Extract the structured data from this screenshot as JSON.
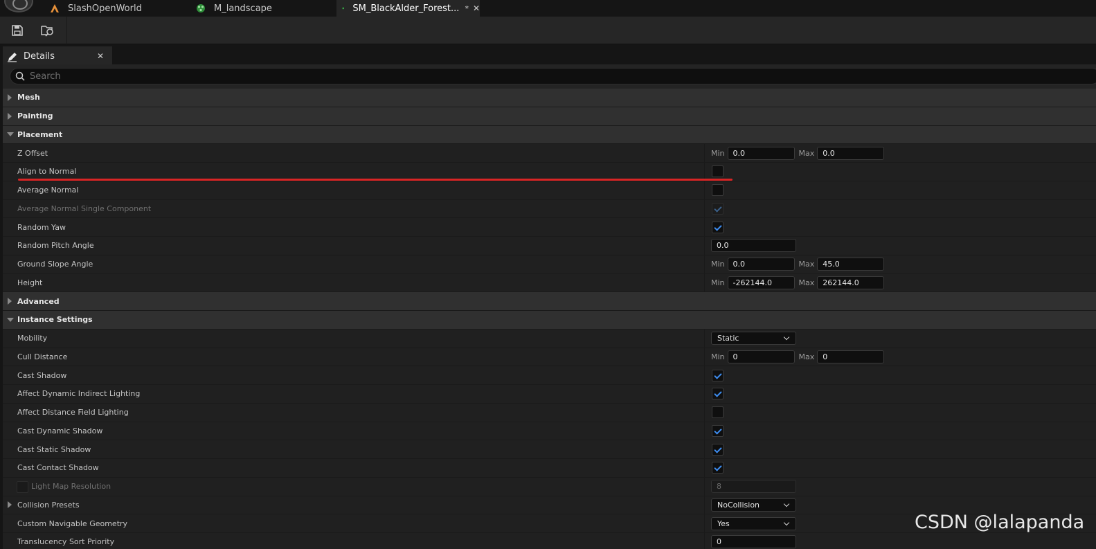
{
  "tabs": [
    {
      "label": "SlashOpenWorld",
      "icon": "level-icon"
    },
    {
      "label": "M_landscape",
      "icon": "material-icon"
    },
    {
      "label": "SM_BlackAlder_Forest...",
      "icon": "foliage-icon",
      "modified": "*",
      "close": "✕"
    }
  ],
  "toolbar": {
    "save": "save-icon",
    "browse": "browse-asset-icon"
  },
  "panel": {
    "title": "Details",
    "close": "✕"
  },
  "search": {
    "placeholder": "Search"
  },
  "rows": [
    {
      "type": "cat",
      "label": "Mesh",
      "expanded": false
    },
    {
      "type": "cat",
      "label": "Painting",
      "expanded": false
    },
    {
      "type": "cat",
      "label": "Placement",
      "expanded": true
    },
    {
      "type": "prop",
      "label": "Z Offset",
      "min": "0.0",
      "max": "0.0"
    },
    {
      "type": "prop",
      "label": "Align to Normal",
      "checked": false
    },
    {
      "type": "prop",
      "label": "Average Normal",
      "checked": false
    },
    {
      "type": "prop",
      "label": "Average Normal Single Component",
      "checked": true,
      "disabled": true
    },
    {
      "type": "prop",
      "label": "Random Yaw",
      "checked": true
    },
    {
      "type": "prop",
      "label": "Random Pitch Angle",
      "value": "0.0"
    },
    {
      "type": "prop",
      "label": "Ground Slope Angle",
      "min": "0.0",
      "max": "45.0"
    },
    {
      "type": "prop",
      "label": "Height",
      "min": "-262144.0",
      "max": "262144.0"
    },
    {
      "type": "cat",
      "label": "Advanced",
      "expanded": false,
      "sub": true
    },
    {
      "type": "cat",
      "label": "Instance Settings",
      "expanded": true
    },
    {
      "type": "prop",
      "label": "Mobility",
      "select": "Static"
    },
    {
      "type": "prop",
      "label": "Cull Distance",
      "min": "0",
      "max": "0"
    },
    {
      "type": "prop",
      "label": "Cast Shadow",
      "checked": true
    },
    {
      "type": "prop",
      "label": "Affect Dynamic Indirect Lighting",
      "checked": true
    },
    {
      "type": "prop",
      "label": "Affect Distance Field Lighting",
      "checked": false
    },
    {
      "type": "prop",
      "label": "Cast Dynamic Shadow",
      "checked": true
    },
    {
      "type": "prop",
      "label": "Cast Static Shadow",
      "checked": true
    },
    {
      "type": "prop",
      "label": "Cast Contact Shadow",
      "checked": true
    },
    {
      "type": "prop",
      "label": "Light Map Resolution",
      "value": "8",
      "disabled": true,
      "override": true
    },
    {
      "type": "prop",
      "label": "Collision Presets",
      "select": "NoCollision",
      "expandable": true
    },
    {
      "type": "prop",
      "label": "Custom Navigable Geometry",
      "select": "Yes"
    },
    {
      "type": "prop",
      "label": "Translucency Sort Priority",
      "value": "0"
    }
  ],
  "labels": {
    "min": "Min",
    "max": "Max"
  },
  "watermark": "CSDN @lalapanda",
  "colors": {
    "accent": "#3e8df0",
    "annotation": "#d92525"
  }
}
